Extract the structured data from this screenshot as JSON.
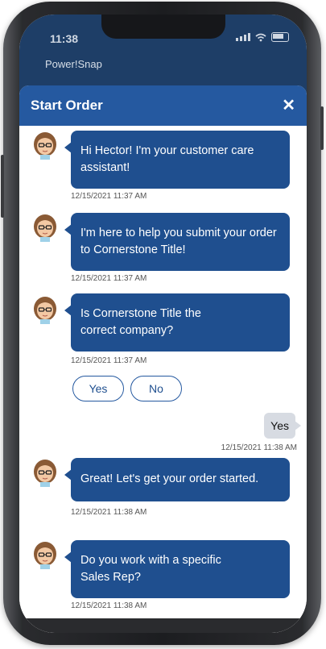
{
  "status": {
    "time": "11:38"
  },
  "app": {
    "name": "Power!Snap"
  },
  "modal": {
    "title": "Start Order",
    "close_label": "✕"
  },
  "messages": [
    {
      "from": "bot",
      "text": "Hi Hector! I'm your customer care assistant!",
      "timestamp": "12/15/2021 11:37 AM"
    },
    {
      "from": "bot",
      "text": "I'm here to help you submit your order to Cornerstone Title!",
      "timestamp": "12/15/2021 11:37 AM"
    },
    {
      "from": "bot",
      "text": "Is Cornerstone Title the correct company?",
      "timestamp": "12/15/2021 11:37 AM"
    },
    {
      "from": "user",
      "text": "Yes",
      "timestamp": "12/15/2021 11:38 AM"
    },
    {
      "from": "bot",
      "text": "Great!  Let's get your order started.",
      "timestamp": "12/15/2021 11:38 AM"
    },
    {
      "from": "bot",
      "text": "Do you work with a specific Sales Rep?",
      "timestamp": "12/15/2021 11:38 AM"
    }
  ],
  "choices": {
    "yes": "Yes",
    "no": "No"
  },
  "colors": {
    "header": "#2559a0",
    "bot_bubble": "#1f4f8f",
    "user_bubble": "#d7dbe2",
    "topbar": "#1e3e67"
  }
}
